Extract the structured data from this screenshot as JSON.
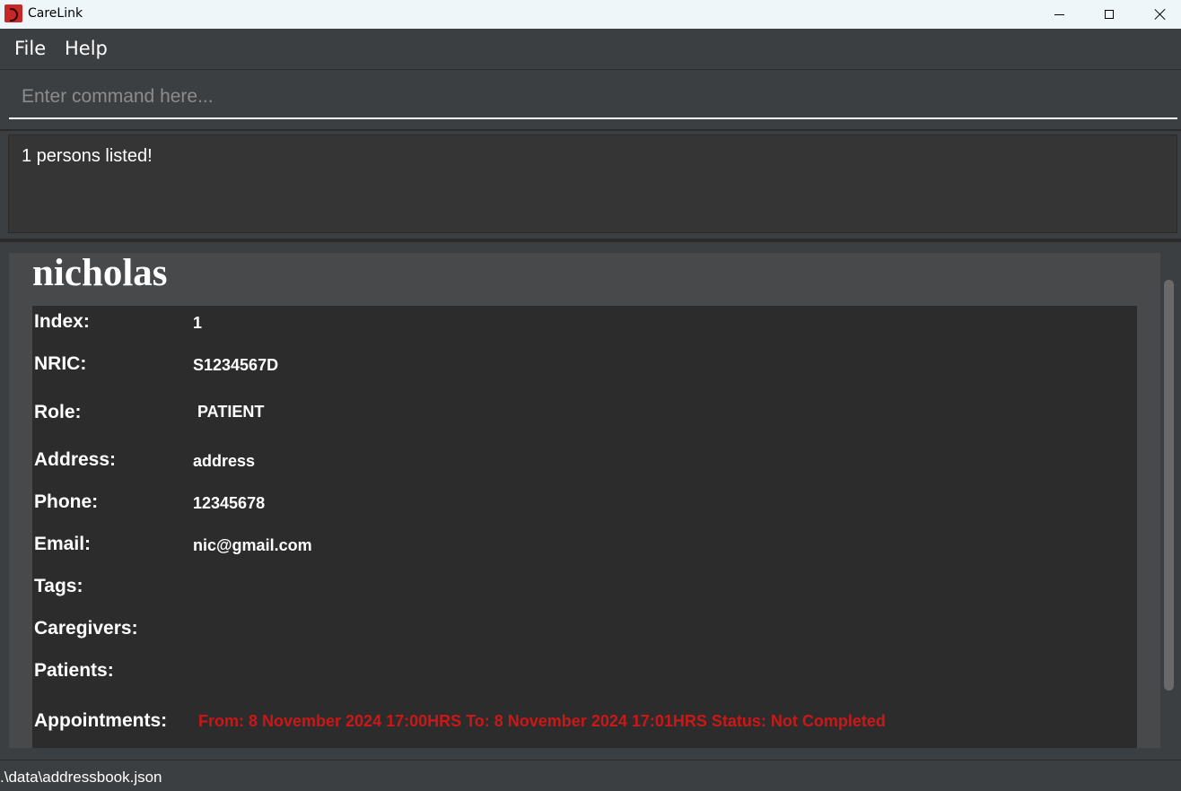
{
  "window": {
    "title": "CareLink"
  },
  "menu": {
    "file": "File",
    "help": "Help"
  },
  "command": {
    "placeholder": "Enter command here...",
    "value": ""
  },
  "result": {
    "message": "1 persons listed!"
  },
  "person": {
    "name": "nicholas",
    "fields": [
      {
        "label": "Index:",
        "value": "1"
      },
      {
        "label": "NRIC:",
        "value": "S1234567D"
      },
      {
        "label": "Role:",
        "value": " PATIENT"
      },
      {
        "label": "Address:",
        "value": "address"
      },
      {
        "label": "Phone:",
        "value": "12345678"
      },
      {
        "label": "Email:",
        "value": "nic@gmail.com"
      },
      {
        "label": "Tags:",
        "value": ""
      },
      {
        "label": "Caregivers:",
        "value": ""
      },
      {
        "label": "Patients:",
        "value": ""
      },
      {
        "label": "Appointments:",
        "value": "From: 8 November 2024 17:00HRS To: 8 November 2024 17:01HRS Status: Not Completed"
      }
    ]
  },
  "status_bar": {
    "path": ".\\data\\addressbook.json"
  },
  "colors": {
    "appointment_text": "#cc1717",
    "background": "#3c3f41",
    "detail_bg": "#2c2c2c"
  }
}
